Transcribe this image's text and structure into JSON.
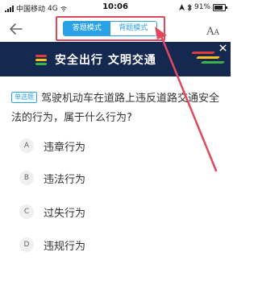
{
  "status_bar": {
    "carrier": "中国移动",
    "network": "4G",
    "time": "10:06",
    "battery": "91%"
  },
  "nav": {
    "modes": [
      {
        "label": "答题模式",
        "active": true
      },
      {
        "label": "背题模式",
        "active": false
      }
    ],
    "font_size_icon": {
      "big": "A",
      "small": "A"
    }
  },
  "banner": {
    "text": "安全出行 文明交通"
  },
  "question": {
    "type_tag": "单选题",
    "text": "驾驶机动车在道路上违反道路交通安全法的行为，属于什么行为?"
  },
  "options": [
    {
      "letter": "A",
      "text": "违章行为"
    },
    {
      "letter": "B",
      "text": "违法行为"
    },
    {
      "letter": "C",
      "text": "过失行为"
    },
    {
      "letter": "D",
      "text": "违规行为"
    }
  ],
  "colors": {
    "accent": "#2aa2e8",
    "annotation": "#e0495d",
    "banner_bg": "#15284f"
  }
}
